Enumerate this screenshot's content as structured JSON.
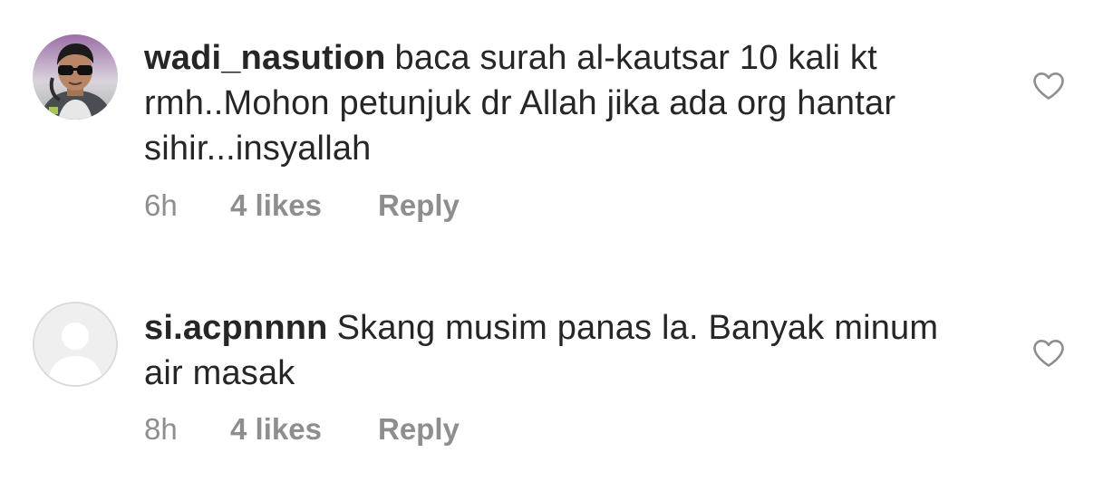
{
  "comments": [
    {
      "username": "wadi_nasution",
      "text": "baca surah al-kautsar 10 kali kt rmh..Mohon petunjuk dr Allah jika ada org hantar sihir...insyallah",
      "time": "6h",
      "likes": "4 likes",
      "reply_label": "Reply",
      "avatar": "user-photo",
      "like_icon": "heart-outline-icon"
    },
    {
      "username": "si.acpnnnn",
      "text": "Skang musim panas la. Banyak minum air masak",
      "time": "8h",
      "likes": "4 likes",
      "reply_label": "Reply",
      "avatar": "default-avatar",
      "like_icon": "heart-outline-icon"
    }
  ],
  "colors": {
    "text": "#262626",
    "meta": "#8e8e8e",
    "heart": "#8e8e8e",
    "default_avatar_bg": "#efefef",
    "default_avatar_fg": "#ffffff"
  }
}
